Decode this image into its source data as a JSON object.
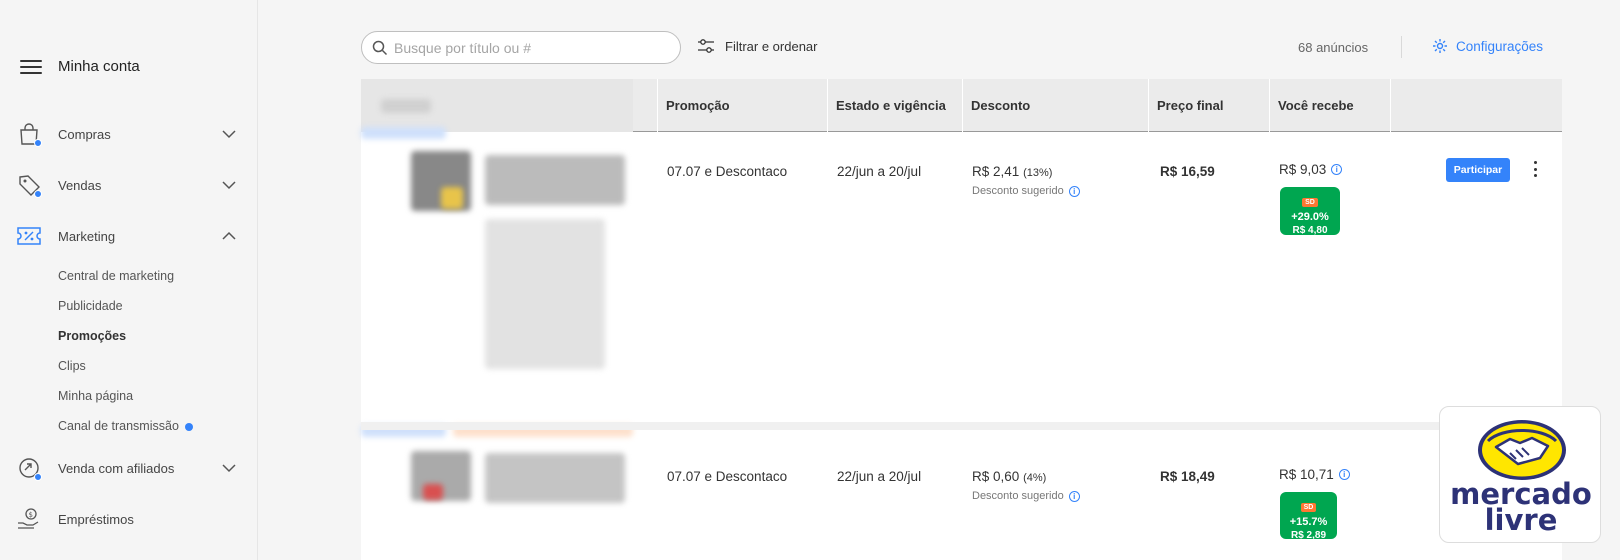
{
  "sidebar": {
    "title": "Minha conta",
    "items": [
      {
        "label": "Compras",
        "icon": "shopping-bag-icon"
      },
      {
        "label": "Vendas",
        "icon": "tag-icon"
      },
      {
        "label": "Marketing",
        "icon": "ticket-discount-icon"
      },
      {
        "label": "Venda com afiliados",
        "icon": "affiliate-icon"
      },
      {
        "label": "Empréstimos",
        "icon": "loan-hand-icon"
      }
    ],
    "marketing_sub": [
      {
        "label": "Central de marketing"
      },
      {
        "label": "Publicidade"
      },
      {
        "label": "Promoções"
      },
      {
        "label": "Clips"
      },
      {
        "label": "Minha página"
      },
      {
        "label": "Canal de transmissão"
      }
    ]
  },
  "toolbar": {
    "search_placeholder": "Busque por título ou #",
    "filter_label": "Filtrar e ordenar",
    "count": "68 anúncios",
    "config_label": "Configurações"
  },
  "table": {
    "headers": [
      "Promoção",
      "Estado e vigência",
      "Desconto",
      "Preço final",
      "Você recebe"
    ],
    "rows": [
      {
        "promo": "07.07 e Descontaco",
        "period": "22/jun a 20/jul",
        "discount": "R$ 2,41",
        "discount_pct": "(13%)",
        "discount_note": "Desconto sugerido",
        "final_price": "R$ 16,59",
        "receive": "R$ 9,03",
        "badge_tag": "SD",
        "badge_pct": "+29.0%",
        "badge_amt": "R$ 4,80",
        "action": "Participar"
      },
      {
        "promo": "07.07 e Descontaco",
        "period": "22/jun a 20/jul",
        "discount": "R$ 0,60",
        "discount_pct": "(4%)",
        "discount_note": "Desconto sugerido",
        "final_price": "R$ 18,49",
        "receive": "R$ 10,71",
        "badge_tag": "SD",
        "badge_pct": "+15.7%",
        "badge_amt": "R$ 2,89"
      }
    ]
  },
  "logo": {
    "line1": "mercado",
    "line2": "livre"
  },
  "colors": {
    "accent": "#3483fa",
    "green": "#00a650",
    "brand_yellow": "#ffe600",
    "brand_navy": "#2d3277"
  }
}
